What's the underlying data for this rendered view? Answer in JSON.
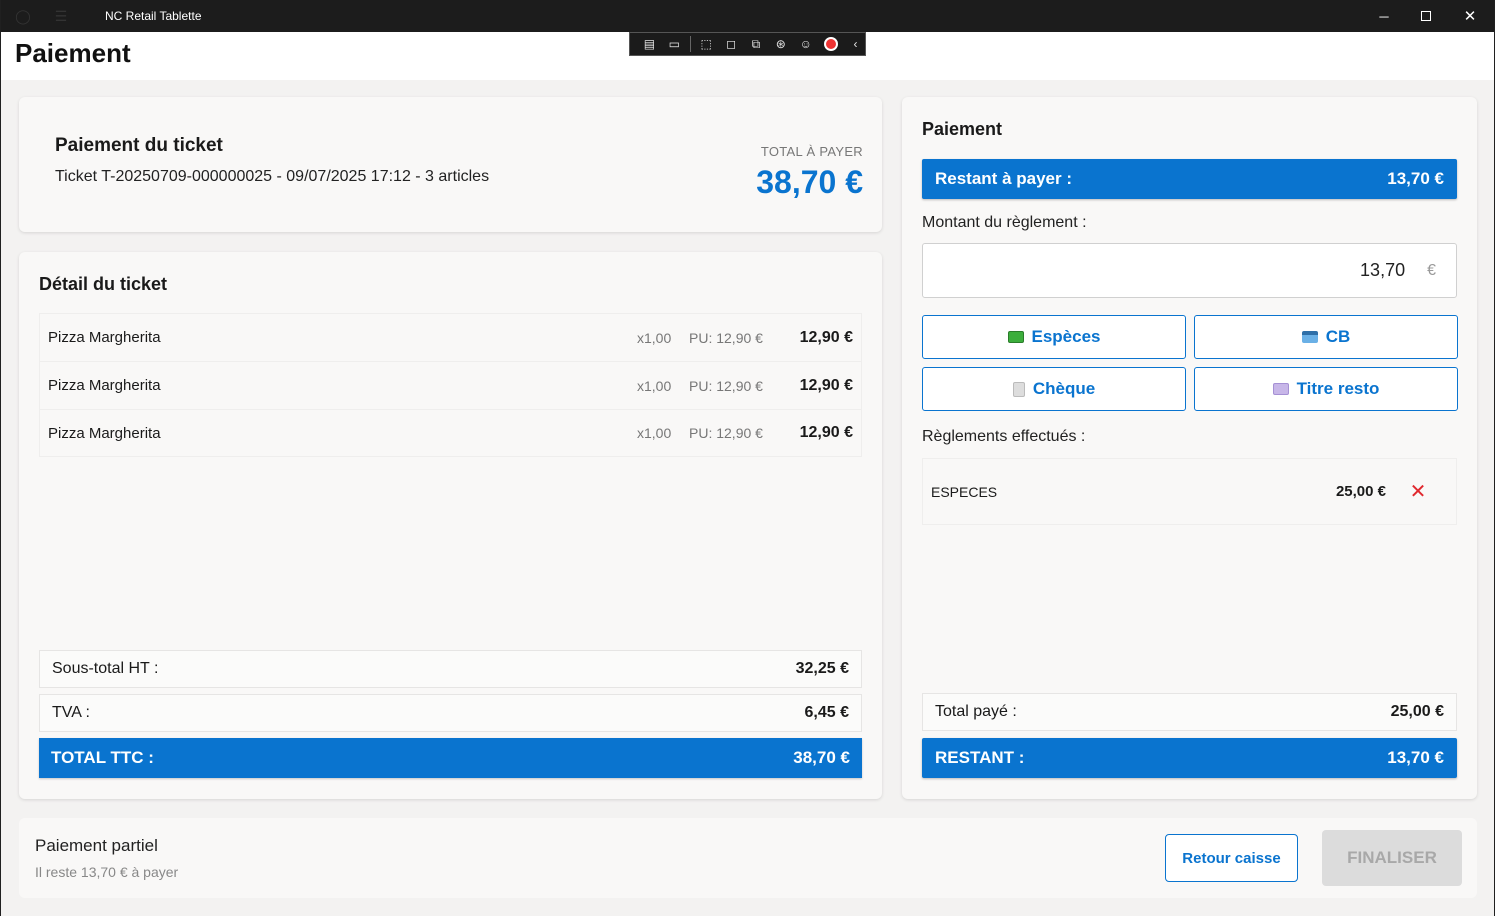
{
  "window": {
    "title": "NC Retail Tablette",
    "minimize": "─",
    "close": "✕"
  },
  "page": {
    "title": "Paiement"
  },
  "ticket": {
    "title": "Paiement du ticket",
    "subtitle": "Ticket T-20250709-000000025 - 09/07/2025 17:12 - 3 articles",
    "total_label": "TOTAL À PAYER",
    "total_amount": "38,70 €"
  },
  "detail": {
    "title": "Détail du ticket",
    "lines": [
      {
        "name": "Pizza Margherita",
        "qty": "x1,00",
        "unit_price": "PU: 12,90 €",
        "amount": "12,90 €"
      },
      {
        "name": "Pizza Margherita",
        "qty": "x1,00",
        "unit_price": "PU: 12,90 €",
        "amount": "12,90 €"
      },
      {
        "name": "Pizza Margherita",
        "qty": "x1,00",
        "unit_price": "PU: 12,90 €",
        "amount": "12,90 €"
      }
    ],
    "subtotal_label": "Sous-total HT :",
    "subtotal_value": "32,25 €",
    "tva_label": "TVA :",
    "tva_value": "6,45 €",
    "total_label": "TOTAL TTC :",
    "total_value": "38,70 €"
  },
  "payment": {
    "title": "Paiement",
    "remaining_label": "Restant à payer :",
    "remaining_value": "13,70 €",
    "amount_label": "Montant du règlement :",
    "amount_value": "13,70",
    "currency": "€",
    "methods": [
      {
        "label": "Espèces",
        "icon": "cash-icon"
      },
      {
        "label": "CB",
        "icon": "credit-card-icon"
      },
      {
        "label": "Chèque",
        "icon": "cheque-icon"
      },
      {
        "label": "Titre resto",
        "icon": "meal-voucher-icon"
      }
    ],
    "done_label": "Règlements effectués :",
    "done": [
      {
        "kind": "ESPECES",
        "amount": "25,00 €",
        "delete_icon": "✕"
      }
    ],
    "total_paid_label": "Total payé :",
    "total_paid_value": "25,00 €",
    "restant_label": "RESTANT :",
    "restant_value": "13,70 €"
  },
  "footer": {
    "title": "Paiement partiel",
    "subtitle": "Il reste 13,70 € à payer",
    "back_label": "Retour caisse",
    "finalize_label": "FINALISER"
  },
  "colors": {
    "accent": "#0a74cf",
    "delete": "#e0282e",
    "disabled": "#dcdcdc"
  }
}
